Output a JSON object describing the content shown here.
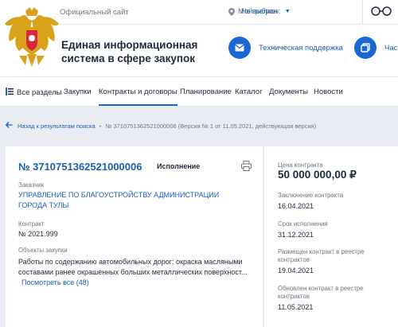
{
  "header": {
    "official_site": "Официальный сайт",
    "region_label": "Мой регион:",
    "region_value": "Не выбран",
    "system_name": "Единая информационная система в сфере закупок",
    "support_label": "Техническая поддержка",
    "faq_label": "Час"
  },
  "nav": {
    "items": [
      "Все разделы",
      "Закупки",
      "Контракты и договоры",
      "Планирование",
      "Каталог",
      "Документы",
      "Новости"
    ],
    "active_index": 2
  },
  "breadcrumb": {
    "back": "Назад к результатам поиска",
    "separator": "•",
    "current": "№ 3710751362521000006 (Версия № 1 от 11.05.2021, действующая версия)"
  },
  "contract": {
    "number": "№ 3710751362521000006",
    "status": "Исполнение",
    "customer_label": "Заказчик",
    "customer": "УПРАВЛЕНИЕ ПО БЛАГОУСТРОЙСТВУ АДМИНИСТРАЦИИ ГОРОДА ТУЛЫ",
    "contract_label": "Контракт",
    "contract_value": "№ 2021.999",
    "objects_label": "Объекты закупки",
    "objects_text": "Работы по содержанию автомобильных дорог: окраска масляными составами ранее окрашенных больших металлических поверхност...",
    "show_all": "Посмотреть все (48)"
  },
  "summary": {
    "price_label": "Цена контракта",
    "price": "50 000 000,00 ₽",
    "conclusion_label": "Заключение контракта",
    "conclusion": "16.04.2021",
    "term_label": "Срок исполнения",
    "term": "31.12.2021",
    "posted_label": "Размещен контракт в реестре контрактов",
    "posted": "19.04.2021",
    "updated_label": "Обновлен контракт в реестре контрактов",
    "updated": "11.05.2021"
  },
  "colors": {
    "accent": "#1a66d2",
    "link": "#1a5fb4",
    "page_bg": "#e9edf3"
  }
}
